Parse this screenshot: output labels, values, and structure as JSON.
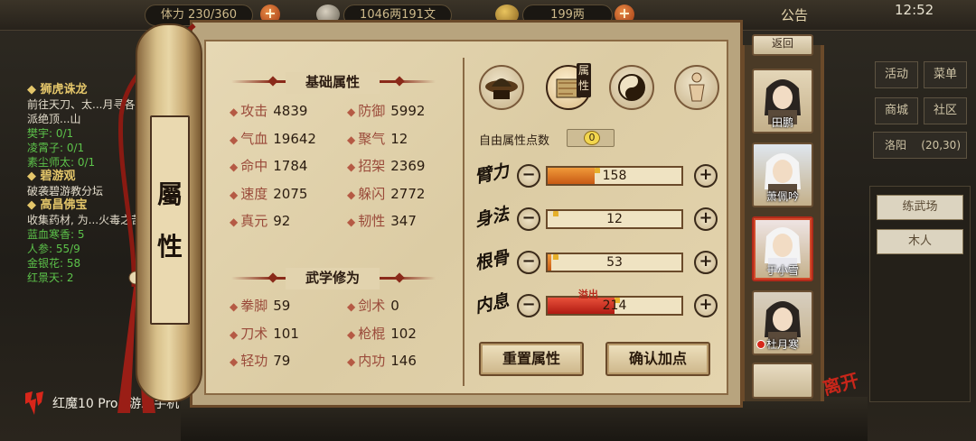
{
  "topbar": {
    "stamina": "体力 230/360",
    "money": "1046两191文",
    "gold": "199两",
    "notice": "公告",
    "time": "12:52"
  },
  "quest_log": [
    {
      "title": "◆ 狮虎诛龙",
      "desc": "前往天刀、太...月寻各派绝顶...山",
      "subs": [
        "樊宇: 0/1",
        "凌霄子: 0/1",
        "素尘师太: 0/1"
      ]
    },
    {
      "title": "◆ 碧游观",
      "desc": "破袭碧游教分坛",
      "subs": []
    },
    {
      "title": "◆ 高昌佛宝",
      "desc": "收集药材, 为...火毒之苦",
      "subs": [
        "蓝血寒香: 5",
        "人参: 55/9",
        "金银花: 58",
        "红景天: 2"
      ]
    }
  ],
  "scroll_tab": {
    "title_line1": "屬",
    "title_line2": "性"
  },
  "basic": {
    "header": "基础属性",
    "stats": [
      {
        "label": "攻击",
        "value": "4839"
      },
      {
        "label": "防御",
        "value": "5992"
      },
      {
        "label": "气血",
        "value": "19642"
      },
      {
        "label": "聚气",
        "value": "12"
      },
      {
        "label": "命中",
        "value": "1784"
      },
      {
        "label": "招架",
        "value": "2369"
      },
      {
        "label": "速度",
        "value": "2075"
      },
      {
        "label": "躲闪",
        "value": "2772"
      },
      {
        "label": "真元",
        "value": "92"
      },
      {
        "label": "韧性",
        "value": "347"
      }
    ]
  },
  "martial": {
    "header": "武学修为",
    "stats": [
      {
        "label": "拳脚",
        "value": "59"
      },
      {
        "label": "剑术",
        "value": "0"
      },
      {
        "label": "刀术",
        "value": "101"
      },
      {
        "label": "枪棍",
        "value": "102"
      },
      {
        "label": "轻功",
        "value": "79"
      },
      {
        "label": "内功",
        "value": "146"
      }
    ]
  },
  "tabs": {
    "icons": [
      "hat-icon",
      "attribute-book-icon",
      "taiji-icon",
      "meridian-body-icon"
    ],
    "attr_tag": "属性"
  },
  "free_points": {
    "label": "自由属性点数",
    "value": "0"
  },
  "attributes": [
    {
      "label": "臂力",
      "value": "158",
      "fill": 0.35,
      "overflow": false
    },
    {
      "label": "身法",
      "value": "12",
      "fill": 0.0,
      "overflow": false
    },
    {
      "label": "根骨",
      "value": "53",
      "fill": 0.03,
      "overflow": false
    },
    {
      "label": "内息",
      "value": "214",
      "fill": 0.5,
      "overflow": true
    }
  ],
  "overflow_label": "溢出",
  "buttons": {
    "reset": "重置属性",
    "confirm": "确认加点"
  },
  "characters": [
    {
      "name": "田鹏",
      "selected": false,
      "alert": false
    },
    {
      "name": "萧佩吟",
      "selected": false,
      "alert": false
    },
    {
      "name": "于小雪",
      "selected": true,
      "alert": false
    },
    {
      "name": "杜月寒",
      "selected": false,
      "alert": true
    }
  ],
  "top_right_partial": "返回",
  "sidebar": {
    "buttons": [
      "活动",
      "菜单",
      "商城",
      "社区"
    ],
    "location": "洛阳",
    "coords": "(20,30)",
    "items": [
      "练武场",
      "木人"
    ]
  },
  "leave": "离开",
  "brand": "红魔10 Pro+游戏手机",
  "colors": {
    "accent_red": "#8a2a1a",
    "bar_orange": "#e07a28",
    "bar_red": "#c8281a",
    "parchment": "#e0d0aa"
  }
}
